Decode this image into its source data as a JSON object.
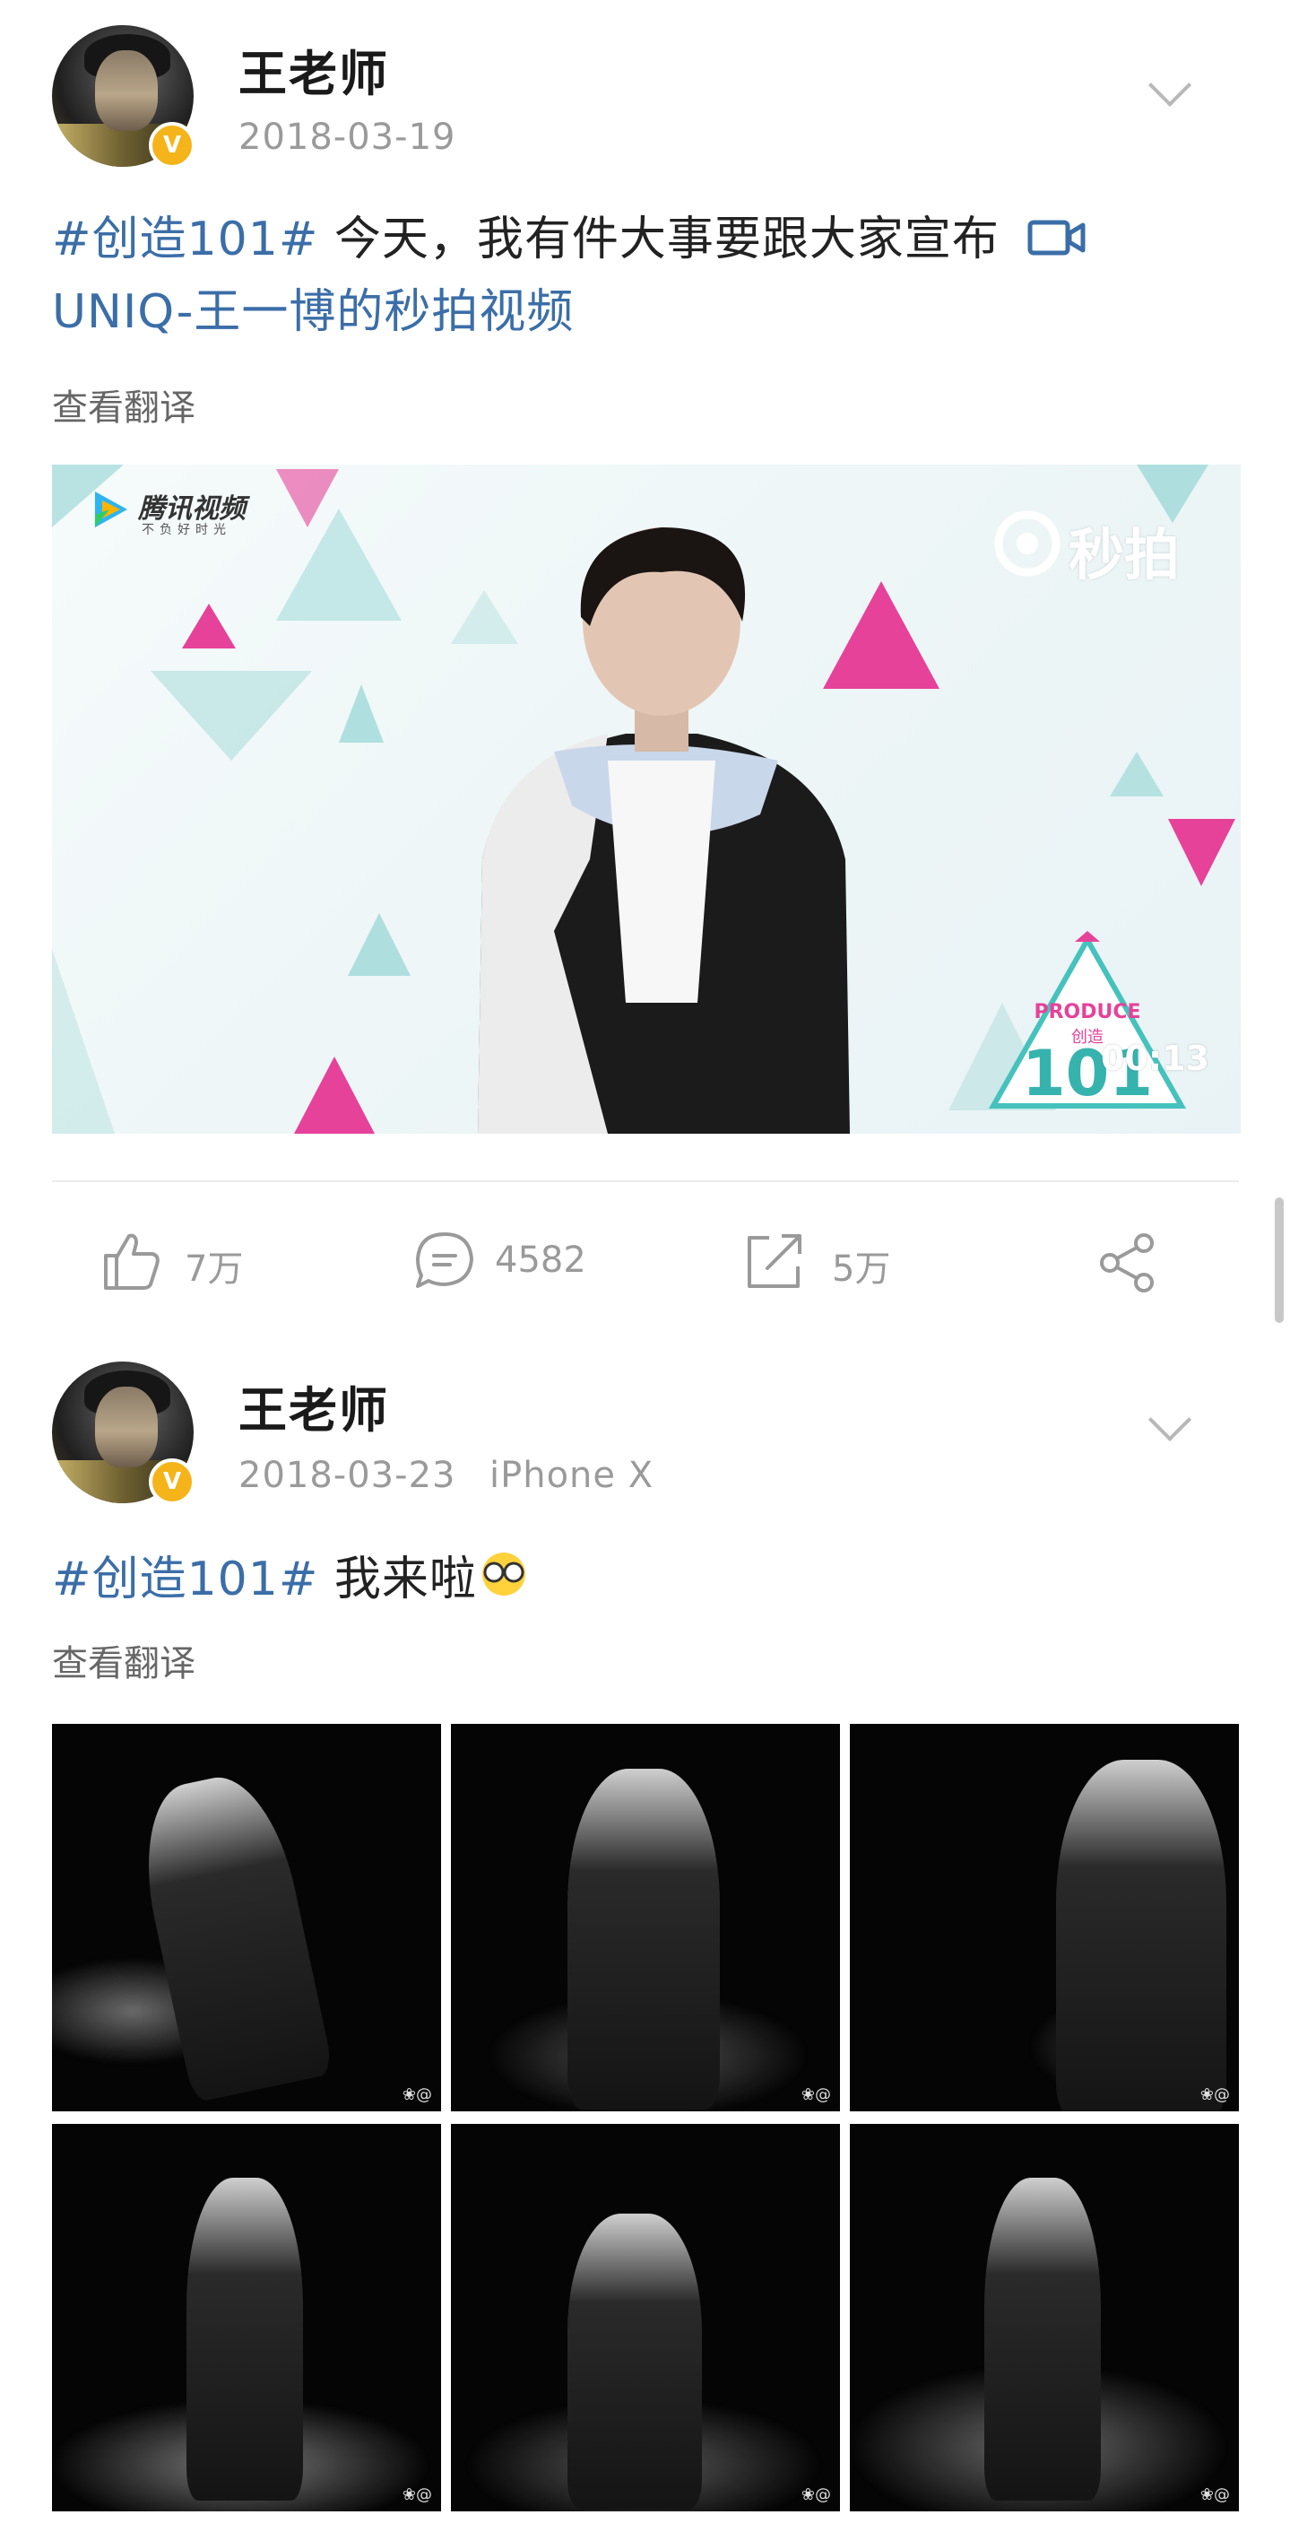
{
  "posts": [
    {
      "username": "王老师",
      "date": "2018-03-19",
      "topic": "#创造101#",
      "text": " 今天，我有件大事要跟大家宣布",
      "video_link": "UNIQ-王一博的秒拍视频",
      "translate": "查看翻译",
      "video": {
        "brand": "腾讯视频",
        "brand_slogan": "不负好时光",
        "miaopai": "秒拍",
        "produce": "PRODUCE",
        "produce_cn": "创造",
        "produce_num": "101",
        "timestamp": "00:13"
      },
      "actions": {
        "likes": "7万",
        "comments": "4582",
        "reposts": "5万"
      }
    },
    {
      "username": "王老师",
      "date": "2018-03-23",
      "device": "iPhone X",
      "topic": "#创造101#",
      "text": " 我来啦",
      "translate": "查看翻译",
      "photo_watermark": "❀@"
    }
  ],
  "icons": [
    "avatar",
    "verified-badge-icon",
    "chevron-down-icon",
    "video-camera-icon",
    "like-icon",
    "comment-icon",
    "repost-icon",
    "share-icon",
    "emoji-icon"
  ],
  "colors": {
    "topic_blue": "#3b6ea8",
    "verified": "#f4b41a",
    "pink": "#e6429a",
    "teal": "#9fd8d8"
  }
}
